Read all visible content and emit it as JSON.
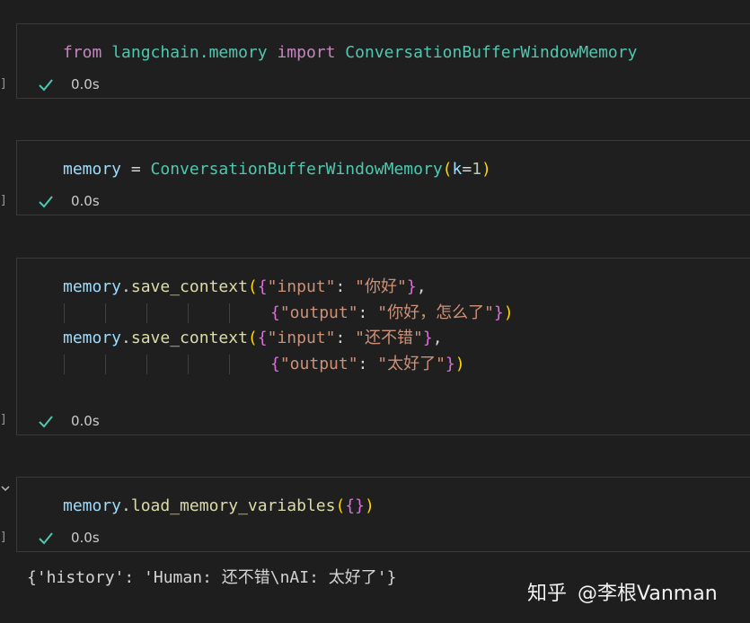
{
  "cells": [
    {
      "status_time": "0.0s",
      "bracket": "]",
      "code": {
        "l1_kw_from": "from",
        "l1_module": " langchain.memory ",
        "l1_kw_import": "import",
        "l1_class": " ConversationBufferWindowMemory"
      }
    },
    {
      "status_time": "0.0s",
      "bracket": "]",
      "code": {
        "l1_var": "memory",
        "l1_eq": " = ",
        "l1_class": "ConversationBufferWindowMemory",
        "l1_open": "(",
        "l1_param": "k",
        "l1_eq2": "=",
        "l1_num": "1",
        "l1_close": ")"
      }
    },
    {
      "status_time": "0.0s",
      "bracket": "]",
      "code": {
        "l1_var": "memory",
        "l1_dot": ".",
        "l1_fn": "save_context",
        "l1_paren": "(",
        "l1_brace": "{",
        "l1_key": "\"input\"",
        "l1_colon": ": ",
        "l1_val": "\"你好\"",
        "l1_brace_close": "}",
        "l1_comma": ",",
        "l2_brace": "{",
        "l2_key": "\"output\"",
        "l2_colon": ": ",
        "l2_val": "\"你好，怎么了\"",
        "l2_brace_close": "}",
        "l2_paren_close": ")",
        "l3_var": "memory",
        "l3_dot": ".",
        "l3_fn": "save_context",
        "l3_paren": "(",
        "l3_brace": "{",
        "l3_key": "\"input\"",
        "l3_colon": ": ",
        "l3_val": "\"还不错\"",
        "l3_brace_close": "}",
        "l3_comma": ",",
        "l4_brace": "{",
        "l4_key": "\"output\"",
        "l4_colon": ": ",
        "l4_val": "\"太好了\"",
        "l4_brace_close": "}",
        "l4_paren_close": ")"
      }
    },
    {
      "status_time": "0.0s",
      "bracket": "]",
      "code": {
        "l1_var": "memory",
        "l1_dot": ".",
        "l1_fn": "load_memory_variables",
        "l1_paren": "(",
        "l1_brace": "{}",
        "l1_paren_close": ")"
      }
    }
  ],
  "output_text": "{'history': 'Human: 还不错\\nAI: 太好了'}",
  "watermark": {
    "site": "知乎",
    "author": "@李根Vanman"
  },
  "colors": {
    "success_check": "#4ec9b0",
    "keyword": "#c586c0",
    "class_name": "#4ec9b0",
    "variable": "#9cdcfe",
    "function": "#dcdcaa",
    "string": "#ce9178"
  }
}
